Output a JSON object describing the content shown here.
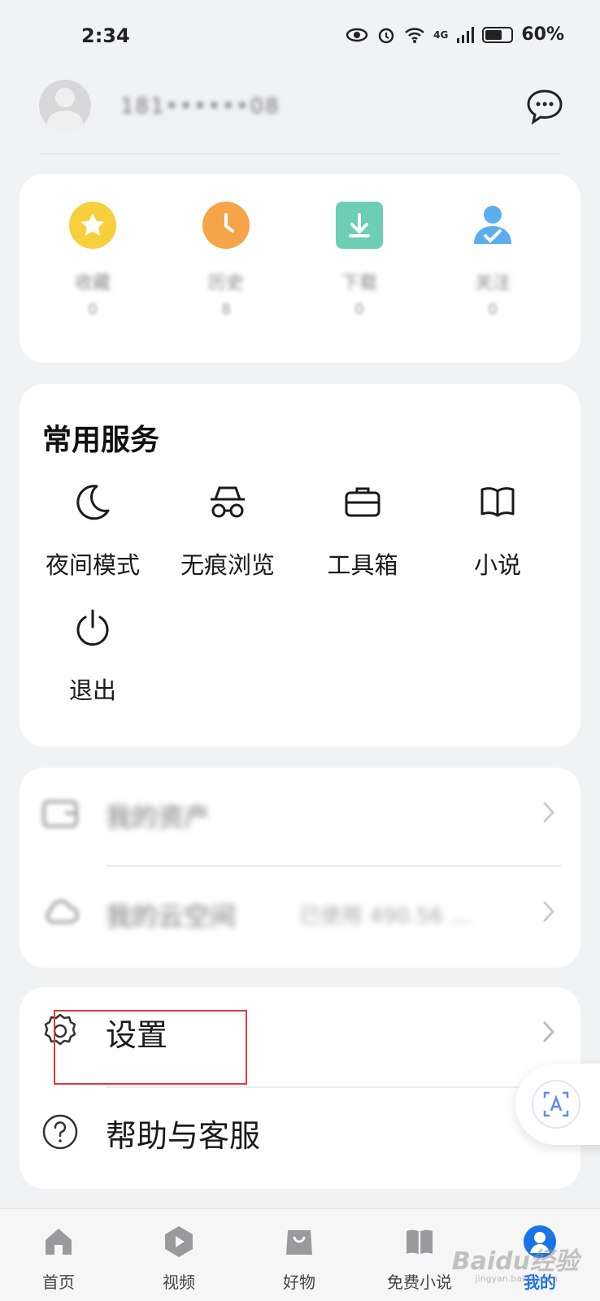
{
  "status_bar": {
    "time": "2:34",
    "network": "4G",
    "battery": "60%"
  },
  "profile": {
    "username": "181••••••08"
  },
  "stats": [
    {
      "label": "收藏",
      "count": "0",
      "icon": "star-icon",
      "color": "#f6cf3a"
    },
    {
      "label": "历史",
      "count": "8",
      "icon": "clock-icon",
      "color": "#f5a44a"
    },
    {
      "label": "下载",
      "count": "0",
      "icon": "download-icon",
      "color": "#6ccfb3"
    },
    {
      "label": "关注",
      "count": "0",
      "icon": "user-check-icon",
      "color": "#5aaef0"
    }
  ],
  "services": {
    "title": "常用服务",
    "items": [
      {
        "label": "夜间模式",
        "icon": "moon-icon"
      },
      {
        "label": "无痕浏览",
        "icon": "incognito-icon"
      },
      {
        "label": "工具箱",
        "icon": "toolbox-icon"
      },
      {
        "label": "小说",
        "icon": "book-icon"
      },
      {
        "label": "退出",
        "icon": "power-icon"
      }
    ]
  },
  "assets": [
    {
      "label": "我的资产",
      "sub": ""
    },
    {
      "label": "我的云空间",
      "sub": "已使用 490.56 …"
    }
  ],
  "settings": {
    "settings_label": "设置",
    "help_label": "帮助与客服"
  },
  "nav": [
    {
      "label": "首页",
      "icon": "home-icon"
    },
    {
      "label": "视频",
      "icon": "video-icon"
    },
    {
      "label": "好物",
      "icon": "shopping-bag-icon"
    },
    {
      "label": "免费小说",
      "icon": "book-icon"
    },
    {
      "label": "我的",
      "icon": "profile-icon"
    }
  ],
  "watermark": {
    "brand": "Baidu经验",
    "url": "jingyan.baidu.com"
  },
  "colors": {
    "accent": "#1a73e8",
    "highlight": "#e23a3a"
  }
}
